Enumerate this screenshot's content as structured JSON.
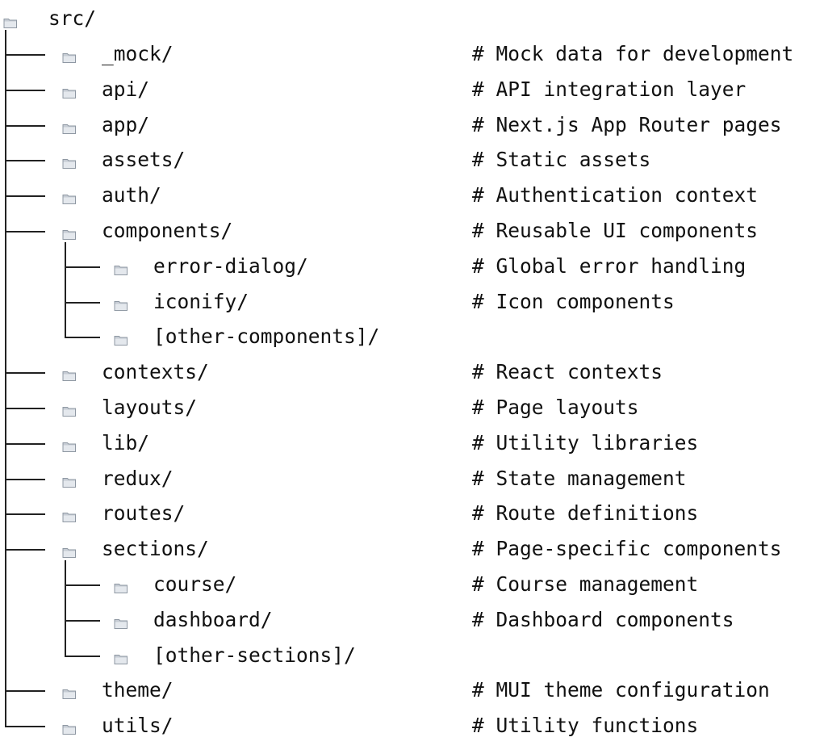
{
  "tree": {
    "root": "src/",
    "items": [
      {
        "name": "_mock/",
        "comment": "# Mock data for development",
        "level": 1,
        "last": false
      },
      {
        "name": "api/",
        "comment": "# API integration layer",
        "level": 1,
        "last": false
      },
      {
        "name": "app/",
        "comment": "# Next.js App Router pages",
        "level": 1,
        "last": false
      },
      {
        "name": "assets/",
        "comment": "# Static assets",
        "level": 1,
        "last": false
      },
      {
        "name": "auth/",
        "comment": "# Authentication context",
        "level": 1,
        "last": false
      },
      {
        "name": "components/",
        "comment": "# Reusable UI components",
        "level": 1,
        "last": false
      },
      {
        "name": "error-dialog/",
        "comment": "# Global error handling",
        "level": 2,
        "last": false
      },
      {
        "name": "iconify/",
        "comment": "# Icon components",
        "level": 2,
        "last": false
      },
      {
        "name": "[other-components]/",
        "comment": "",
        "level": 2,
        "last": true
      },
      {
        "name": "contexts/",
        "comment": "# React contexts",
        "level": 1,
        "last": false
      },
      {
        "name": "layouts/",
        "comment": "# Page layouts",
        "level": 1,
        "last": false
      },
      {
        "name": "lib/",
        "comment": "# Utility libraries",
        "level": 1,
        "last": false
      },
      {
        "name": "redux/",
        "comment": "# State management",
        "level": 1,
        "last": false
      },
      {
        "name": "routes/",
        "comment": "# Route definitions",
        "level": 1,
        "last": false
      },
      {
        "name": "sections/",
        "comment": "# Page-specific components",
        "level": 1,
        "last": false
      },
      {
        "name": "course/",
        "comment": "# Course management",
        "level": 2,
        "last": false
      },
      {
        "name": "dashboard/",
        "comment": "# Dashboard components",
        "level": 2,
        "last": false
      },
      {
        "name": "[other-sections]/",
        "comment": "",
        "level": 2,
        "last": true
      },
      {
        "name": "theme/",
        "comment": "# MUI theme configuration",
        "level": 1,
        "last": false
      },
      {
        "name": "utils/",
        "comment": "# Utility functions",
        "level": 1,
        "last": true
      }
    ]
  },
  "icons": {
    "folder": "folder-icon"
  },
  "colors": {
    "text": "#111111",
    "lines": "#222222",
    "folder_light": "#d9dde3",
    "folder_dark": "#9aa3ad"
  }
}
